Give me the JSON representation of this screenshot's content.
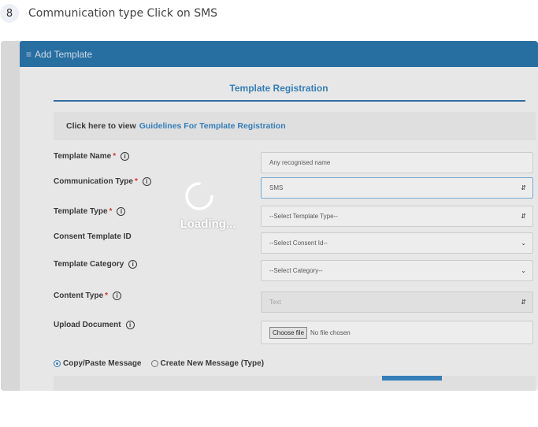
{
  "step": {
    "number": "8",
    "text": "Communication type Click on SMS"
  },
  "topbar": {
    "menu_icon": "hamburger-icon",
    "title": "Add Template"
  },
  "form": {
    "title": "Template Registration",
    "guide_prefix": "Click here to view",
    "guide_link": "Guidelines For Template Registration",
    "fields": [
      {
        "label": "Template Name",
        "required": "*",
        "info": "i",
        "value": "Any recognised name"
      },
      {
        "label": "Communication Type",
        "required": "*",
        "info": "i",
        "value": "SMS"
      },
      {
        "label": "Template Type",
        "required": "*",
        "info": "i",
        "value": "--Select Template Type--"
      },
      {
        "label": "Consent Template ID",
        "value": "--Select Consent Id--"
      },
      {
        "label": "Template Category",
        "info": "i",
        "value": "--Select Category--"
      },
      {
        "label": "Content Type",
        "required": "*",
        "info": "i",
        "value": "Text"
      },
      {
        "label": "Upload Document",
        "info": "i",
        "file_button": "Choose file",
        "file_status": "No file chosen"
      }
    ],
    "message_options": [
      {
        "label": "Copy/Paste Message",
        "selected": true
      },
      {
        "label": "Create New Message (Type)",
        "selected": false
      }
    ]
  },
  "loading": {
    "text": "Loading..."
  },
  "colors": {
    "accent": "#1f6ea6",
    "link": "#2f7fbf",
    "required": "#d9342b"
  }
}
